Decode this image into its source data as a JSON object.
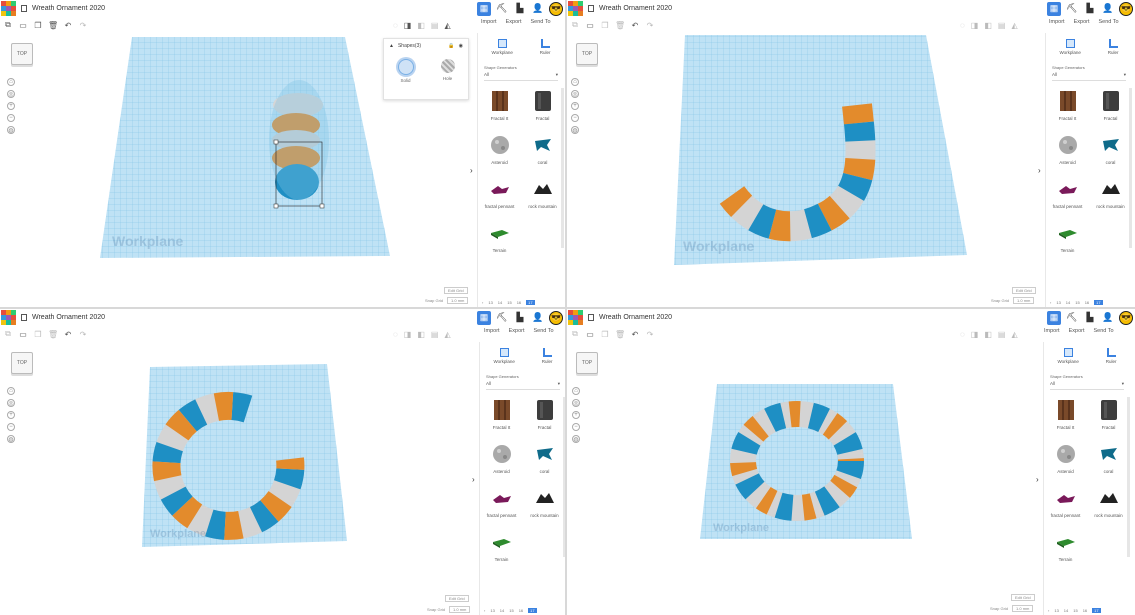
{
  "title": "Wreath Ornament 2020",
  "actions": {
    "import": "Import",
    "export": "Export",
    "send_to": "Send To"
  },
  "viewcube_label": "TOP",
  "sidebar": {
    "workplane": "Workplane",
    "ruler": "Ruler",
    "category_label": "Shape Generators",
    "category_value": "All",
    "shapes": [
      "Fractal It",
      "Fractal",
      "Asteroid",
      "coral",
      "fractal pennant",
      "rock mountain",
      "Terrain"
    ]
  },
  "shapes_panel": {
    "title": "Shapes(3)",
    "solid": "Solid",
    "hole": "Hole"
  },
  "workplane_label": "Workplane",
  "edit_grid": "Edit Grid",
  "snap_grid_label": "Snap Grid",
  "snap_grid_value": "1.0 mm",
  "pager": [
    "13",
    "14",
    "15",
    "16",
    "17"
  ],
  "colors": {
    "accent": "#3b82e0",
    "grid": "#9dd3f0",
    "orange": "#e38b2c",
    "blue": "#1e8fc4",
    "white": "#d8d8d8"
  }
}
